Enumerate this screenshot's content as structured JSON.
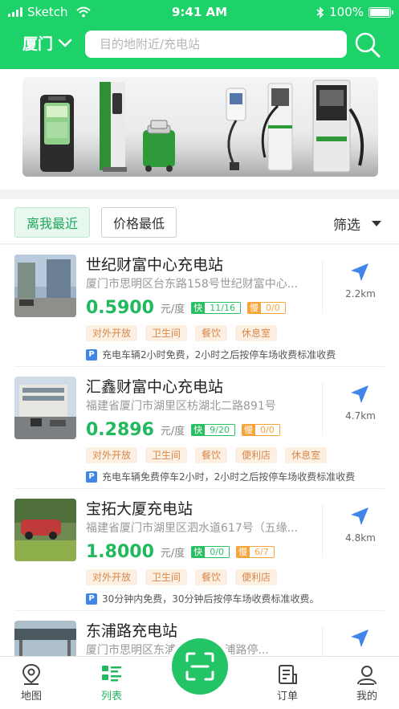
{
  "statusbar": {
    "carrier": "Sketch",
    "time": "9:41 AM",
    "battery": "100%",
    "battery_level": 1.0
  },
  "header": {
    "city": "厦门",
    "search_placeholder": "目的地附近/充电站"
  },
  "filters": {
    "nearest": "离我最近",
    "cheapest": "价格最低",
    "filter": "筛选"
  },
  "stations": [
    {
      "name": "世纪财富中心充电站",
      "address": "厦门市思明区台东路158号世纪财富中心...",
      "price": "0.5900",
      "unit": "元/度",
      "fast_label": "快",
      "fast_value": "11/16",
      "slow_label": "慢",
      "slow_value": "0/0",
      "tags": [
        "对外开放",
        "卫生间",
        "餐饮",
        "休息室"
      ],
      "parking": "充电车辆2小时免费，2小时之后按停车场收费标准收费",
      "distance": "2.2km"
    },
    {
      "name": "汇鑫财富中心充电站",
      "address": "福建省厦门市湖里区枋湖北二路891号",
      "price": "0.2896",
      "unit": "元/度",
      "fast_label": "快",
      "fast_value": "9/20",
      "slow_label": "慢",
      "slow_value": "0/0",
      "tags": [
        "对外开放",
        "卫生间",
        "餐饮",
        "便利店",
        "休息室"
      ],
      "parking": "充电车辆免费停车2小时，2小时之后按停车场收费标准收费",
      "distance": "4.7km"
    },
    {
      "name": "宝拓大厦充电站",
      "address": "福建省厦门市湖里区泗水道617号（五缘...",
      "price": "1.8000",
      "unit": "元/度",
      "fast_label": "快",
      "fast_value": "0/0",
      "slow_label": "慢",
      "slow_value": "6/7",
      "tags": [
        "对外开放",
        "卫生间",
        "餐饮",
        "便利店"
      ],
      "parking": "30分钟内免费，30分钟后按停车场收费标准收费。",
      "distance": "4.8km"
    },
    {
      "name": "东浦路充电站",
      "address": "厦门市思明区东浦路 号（东浦路停...",
      "price": "",
      "unit": "",
      "fast_label": "",
      "fast_value": "",
      "slow_label": "",
      "slow_value": "",
      "tags": [],
      "parking": "",
      "distance": ""
    }
  ],
  "parking_icon": "P",
  "tabbar": {
    "map": "地图",
    "list": "列表",
    "orders": "订单",
    "mine": "我的"
  },
  "colors": {
    "brand": "#1ed26a",
    "price": "#22b85e",
    "tag_bg": "#fdf0e2",
    "tag_text": "#d9874a",
    "fast": "#2bbf63",
    "slow": "#f6a43b",
    "parking": "#3f86e8",
    "nav_arrow": "#3f86e8"
  },
  "icons": [
    "wifi-icon",
    "bluetooth-icon",
    "battery-icon",
    "chevron-down-icon",
    "search-icon",
    "location-arrow-icon",
    "map-icon",
    "list-icon",
    "scan-icon",
    "order-icon",
    "profile-icon"
  ]
}
